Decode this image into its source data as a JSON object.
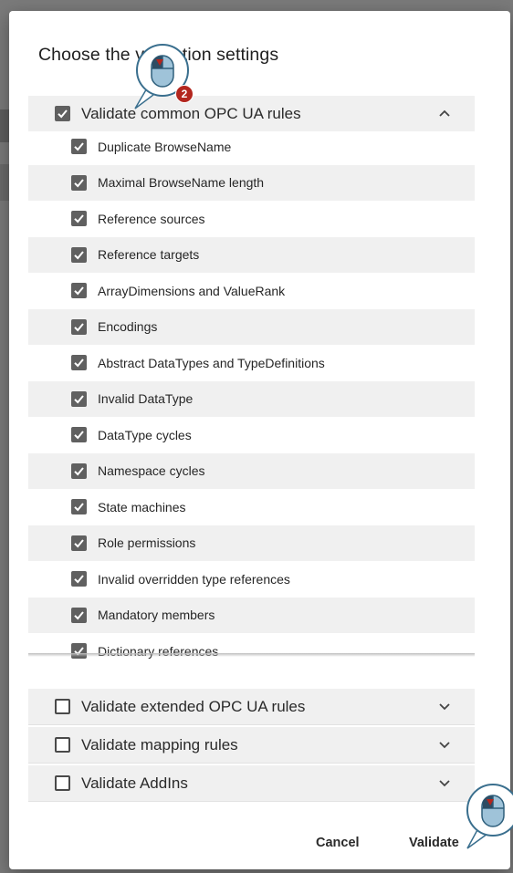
{
  "dialog": {
    "title": "Choose the validation settings",
    "cancel_label": "Cancel",
    "validate_label": "Validate"
  },
  "sections": [
    {
      "label": "Validate common OPC UA rules",
      "checked": true,
      "expanded": true
    },
    {
      "label": "Validate extended OPC UA rules",
      "checked": false,
      "expanded": false
    },
    {
      "label": "Validate mapping rules",
      "checked": false,
      "expanded": false
    },
    {
      "label": "Validate AddIns",
      "checked": false,
      "expanded": false
    }
  ],
  "common_rules": [
    {
      "label": "Duplicate BrowseName",
      "checked": true
    },
    {
      "label": "Maximal BrowseName length",
      "checked": true
    },
    {
      "label": "Reference sources",
      "checked": true
    },
    {
      "label": "Reference targets",
      "checked": true
    },
    {
      "label": "ArrayDimensions and ValueRank",
      "checked": true
    },
    {
      "label": "Encodings",
      "checked": true
    },
    {
      "label": "Abstract DataTypes and TypeDefinitions",
      "checked": true
    },
    {
      "label": "Invalid DataType",
      "checked": true
    },
    {
      "label": "DataType cycles",
      "checked": true
    },
    {
      "label": "Namespace cycles",
      "checked": true
    },
    {
      "label": "State machines",
      "checked": true
    },
    {
      "label": "Role permissions",
      "checked": true
    },
    {
      "label": "Invalid overridden type references",
      "checked": true
    },
    {
      "label": "Mandatory members",
      "checked": true
    },
    {
      "label": "Dictionary references",
      "checked": true
    }
  ],
  "annotations": {
    "step_badge": "2"
  },
  "colors": {
    "checkbox": "#606060",
    "panel": "#f0f0f0",
    "badge": "#b3261e",
    "cursor_body": "#9fc3d9"
  }
}
